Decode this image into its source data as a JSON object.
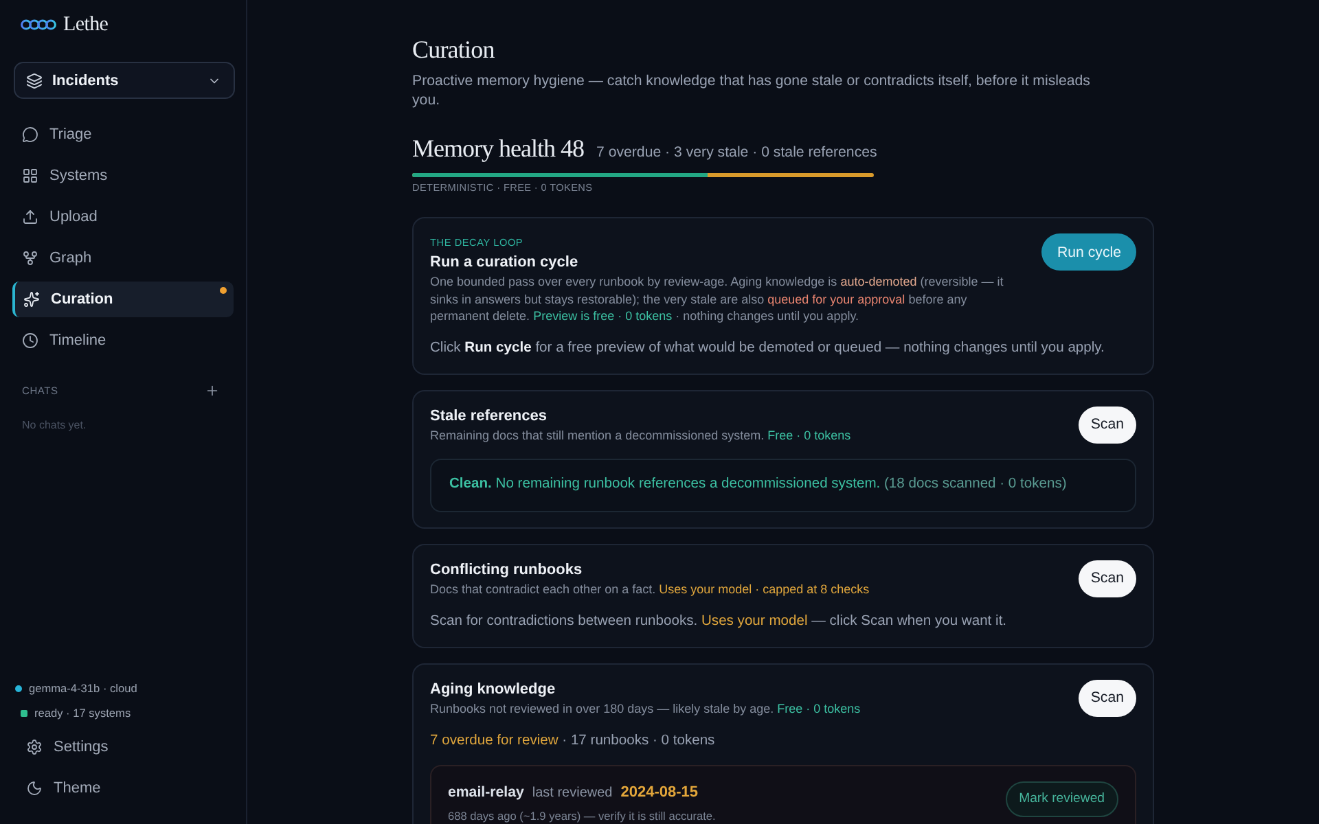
{
  "sidebar": {
    "brand": "Lethe",
    "workspace": "Incidents",
    "nav": [
      {
        "label": "Triage",
        "selected": false,
        "flagged": false
      },
      {
        "label": "Systems",
        "selected": false,
        "flagged": false
      },
      {
        "label": "Upload",
        "selected": false,
        "flagged": false
      },
      {
        "label": "Graph",
        "selected": false,
        "flagged": false
      },
      {
        "label": "Curation",
        "selected": true,
        "flagged": true
      },
      {
        "label": "Timeline",
        "selected": false,
        "flagged": false
      }
    ],
    "chats": {
      "heading": "CHATS",
      "empty": "No chats yet."
    },
    "status": [
      {
        "text": "gemma-4-31b · cloud",
        "color": "#27b4d8"
      },
      {
        "text": "ready · 17 systems",
        "color": "#2fbf8f"
      }
    ],
    "footer": [
      {
        "label": "Settings"
      },
      {
        "label": "Theme"
      }
    ]
  },
  "page": {
    "title": "Curation",
    "subtitle": "Proactive memory hygiene — catch knowledge that has gone stale or contradicts itself, before it misleads you."
  },
  "health": {
    "title": "Memory health 48",
    "summary": "7 overdue · 3 very stale · 0 stale references",
    "level": 0.64,
    "note": "DETERMINISTIC · FREE · 0 TOKENS"
  },
  "cards": [
    {
      "eyebrow": "THE DECAY LOOP",
      "title": "Run a curation cycle",
      "description": [
        {
          "kind": "text",
          "text": "One bounded pass over every runbook by review-age. Aging knowledge is "
        },
        {
          "kind": "peach",
          "text": "auto-demoted"
        },
        {
          "kind": "text",
          "text": " (reversible — it sinks in answers but stays restorable); the very stale are also "
        },
        {
          "kind": "red",
          "text": "queued for your approval"
        },
        {
          "kind": "text",
          "text": " before any permanent delete. "
        },
        {
          "kind": "ok",
          "text": "Preview is free · 0 tokens"
        },
        {
          "kind": "text",
          "text": " · nothing changes until you apply."
        }
      ],
      "action": {
        "label": "Run cycle",
        "kind": "primary"
      },
      "body": [
        {
          "kind": "text",
          "text": "Click "
        },
        {
          "kind": "strong",
          "text": "Run cycle"
        },
        {
          "kind": "text",
          "text": " for a free preview of what would be demoted or queued — nothing changes until you apply."
        }
      ]
    },
    {
      "title": "Stale references",
      "description": [
        {
          "kind": "text",
          "text": "Remaining docs that still mention a decommissioned system. "
        },
        {
          "kind": "ok",
          "text": "Free · 0 tokens"
        }
      ],
      "action": {
        "label": "Scan",
        "kind": "secondary"
      },
      "result": [
        {
          "kind": "ok_strong",
          "text": "Clean."
        },
        {
          "kind": "ok",
          "text": " No remaining runbook references a decommissioned system."
        },
        {
          "kind": "ok_dim",
          "text": " (18 docs scanned · 0 tokens)"
        }
      ]
    },
    {
      "title": "Conflicting runbooks",
      "description": [
        {
          "kind": "text",
          "text": "Docs that contradict each other on a fact. "
        },
        {
          "kind": "amber",
          "text": "Uses your model · capped at 8 checks"
        }
      ],
      "action": {
        "label": "Scan",
        "kind": "secondary"
      },
      "body": [
        {
          "kind": "text",
          "text": "Scan for contradictions between runbooks. "
        },
        {
          "kind": "amber",
          "text": "Uses your model"
        },
        {
          "kind": "text",
          "text": " — click Scan when you want it."
        }
      ]
    },
    {
      "title": "Aging knowledge",
      "description": [
        {
          "kind": "text",
          "text": "Runbooks not reviewed in over 180 days — likely stale by age. "
        },
        {
          "kind": "ok",
          "text": "Free · 0 tokens"
        }
      ],
      "action": {
        "label": "Scan",
        "kind": "secondary"
      },
      "body": [
        {
          "kind": "amber",
          "text": "7 overdue for review"
        },
        {
          "kind": "text",
          "text": " · 17 runbooks · 0 tokens"
        }
      ],
      "items": [
        {
          "name": "email-relay",
          "label": "last reviewed",
          "date": "2024-08-15",
          "detail": "688 days ago (~1.9 years) — verify it is still accurate.",
          "action": "Mark reviewed"
        }
      ]
    }
  ]
}
